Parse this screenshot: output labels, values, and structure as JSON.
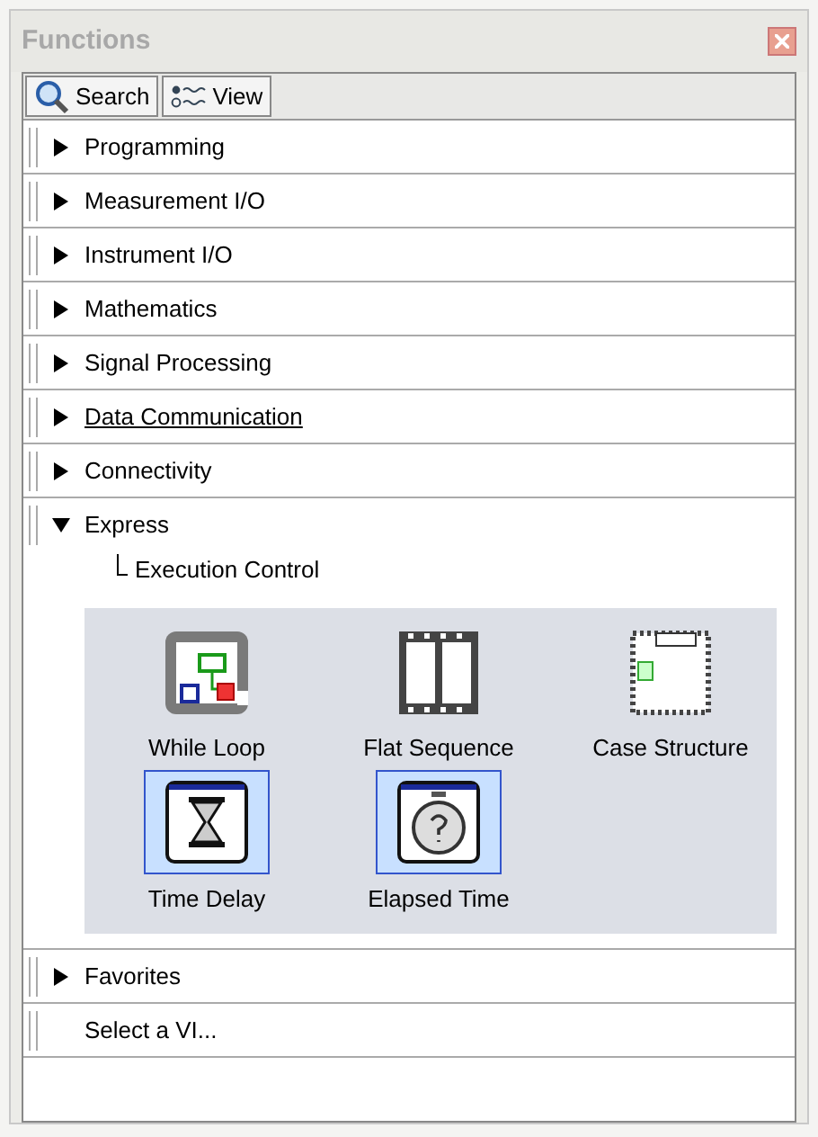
{
  "window": {
    "title": "Functions"
  },
  "toolbar": [
    {
      "label": "Search",
      "kind": "search"
    },
    {
      "label": "View",
      "kind": "view"
    }
  ],
  "categories": [
    {
      "label": "Programming",
      "kind": "category",
      "expanded": false,
      "hovered": false
    },
    {
      "label": "Measurement I/O",
      "kind": "category",
      "expanded": false,
      "hovered": false
    },
    {
      "label": "Instrument I/O",
      "kind": "category",
      "expanded": false,
      "hovered": false
    },
    {
      "label": "Mathematics",
      "kind": "category",
      "expanded": false,
      "hovered": false
    },
    {
      "label": "Signal Processing",
      "kind": "category",
      "expanded": false,
      "hovered": false
    },
    {
      "label": "Data Communication",
      "kind": "category",
      "expanded": false,
      "hovered": true
    },
    {
      "label": "Connectivity",
      "kind": "category",
      "expanded": false,
      "hovered": false
    },
    {
      "label": "Express",
      "kind": "category",
      "expanded": true,
      "hovered": false,
      "children": [
        {
          "label": "Execution Control",
          "items": [
            {
              "label": "While Loop",
              "kind": "loop"
            },
            {
              "label": "Flat Sequence",
              "kind": "sequence"
            },
            {
              "label": "Case Structure",
              "kind": "case"
            },
            {
              "label": "Time Delay",
              "kind": "delay"
            },
            {
              "label": "Elapsed Time",
              "kind": "timer"
            }
          ]
        }
      ]
    },
    {
      "label": "Favorites",
      "kind": "category",
      "expanded": false,
      "hovered": false
    },
    {
      "label": "Select a VI...",
      "kind": "action",
      "hovered": false
    }
  ]
}
